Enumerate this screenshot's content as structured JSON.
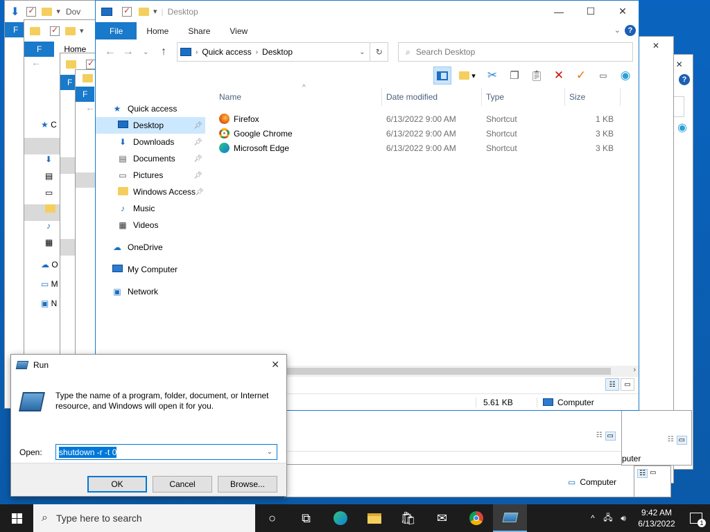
{
  "explorer": {
    "title": "Desktop",
    "ribbon_tabs": [
      "File",
      "Home",
      "Share",
      "View"
    ],
    "breadcrumb": [
      "Quick access",
      "Desktop"
    ],
    "search_placeholder": "Search Desktop",
    "nav": {
      "quick_access": "Quick access",
      "items": [
        {
          "label": "Desktop",
          "icon": "desktop-icon"
        },
        {
          "label": "Downloads",
          "icon": "download-arrow-icon"
        },
        {
          "label": "Documents",
          "icon": "document-icon"
        },
        {
          "label": "Pictures",
          "icon": "pictures-icon"
        },
        {
          "label": "Windows Access",
          "icon": "folder-icon"
        },
        {
          "label": "Music",
          "icon": "music-note-icon"
        },
        {
          "label": "Videos",
          "icon": "film-icon"
        }
      ],
      "onedrive": "OneDrive",
      "my_computer": "My Computer",
      "network": "Network"
    },
    "columns": [
      "Name",
      "Date modified",
      "Type",
      "Size"
    ],
    "files": [
      {
        "name": "Firefox",
        "date": "6/13/2022 9:00 AM",
        "type": "Shortcut",
        "size": "1 KB",
        "color": "#e66000"
      },
      {
        "name": "Google Chrome",
        "date": "6/13/2022 9:00 AM",
        "type": "Shortcut",
        "size": "3 KB",
        "color": "#db4437"
      },
      {
        "name": "Microsoft Edge",
        "date": "6/13/2022 9:00 AM",
        "type": "Shortcut",
        "size": "3 KB",
        "color": "#0c7fd6"
      }
    ],
    "status_size": "5.61 KB",
    "status_location": "Computer"
  },
  "background": {
    "title_partial": "Dov",
    "file_tab": "F",
    "home_tab": "Home",
    "status_location": "Computer",
    "status_location_partial": "puter",
    "left_nav_partial": [
      "C",
      "O",
      "M",
      "N"
    ]
  },
  "run": {
    "title": "Run",
    "description": "Type the name of a program, folder, document, or Internet resource, and Windows will open it for you.",
    "open_label": "Open:",
    "command": "shutdown -r -t 0",
    "ok": "OK",
    "cancel": "Cancel",
    "browse": "Browse..."
  },
  "taskbar": {
    "search_placeholder": "Type here to search",
    "time": "9:42 AM",
    "date": "6/13/2022",
    "notification_count": "1"
  }
}
